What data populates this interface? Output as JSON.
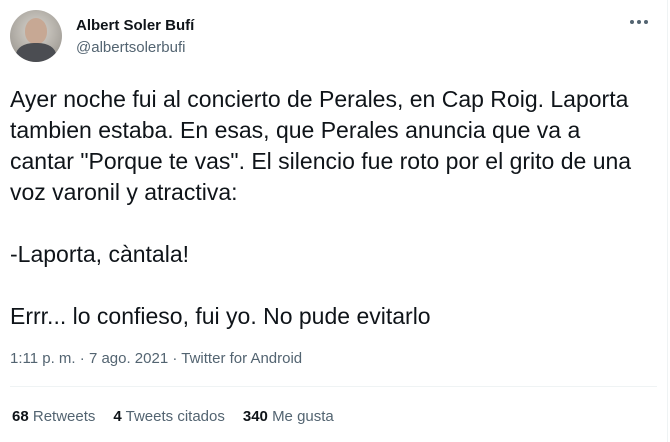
{
  "author": {
    "display_name": "Albert Soler Bufí",
    "handle": "@albertsolerbufi"
  },
  "menu_icon": "more-horizontal-icon",
  "tweet": {
    "paragraph1": "Ayer noche fui al concierto de Perales, en Cap Roig. Laporta tambien estaba. En esas, que Perales anuncia que va a cantar \"Porque te vas\". El silencio fue roto por el grito de una voz varonil y atractiva:",
    "paragraph2": "-Laporta, càntala!",
    "paragraph3": "Errr... lo confieso, fui yo. No pude evitarlo"
  },
  "meta": {
    "time": "1:11 p. m.",
    "separator1": "·",
    "date": "7 ago. 2021",
    "separator2": "·",
    "source": "Twitter for Android"
  },
  "stats": {
    "retweets_count": "68",
    "retweets_label": "Retweets",
    "quotes_count": "4",
    "quotes_label": "Tweets citados",
    "likes_count": "340",
    "likes_label": "Me gusta"
  },
  "colors": {
    "text": "#0f1419",
    "secondary": "#536471",
    "divider": "#eff3f4"
  }
}
